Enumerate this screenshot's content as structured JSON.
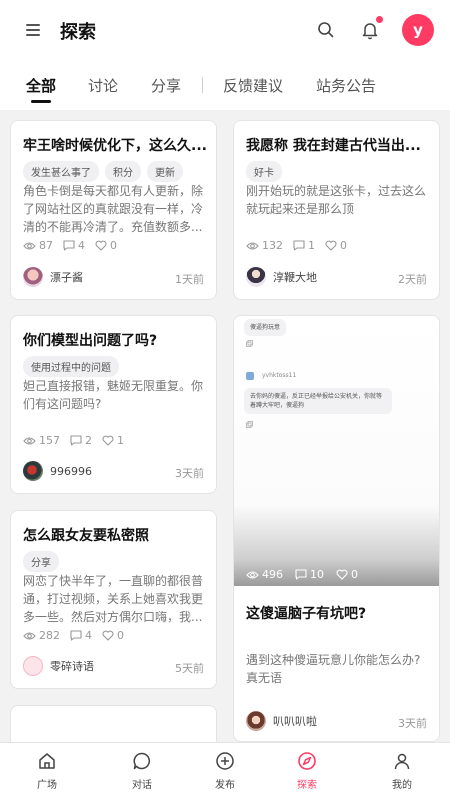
{
  "header": {
    "title": "探索",
    "avatar_letter": "y"
  },
  "tabs": [
    {
      "label": "全部",
      "active": true
    },
    {
      "label": "讨论"
    },
    {
      "label": "分享"
    },
    {
      "label": "反馈建议"
    },
    {
      "label": "站务公告"
    }
  ],
  "posts": [
    {
      "title": "牢王啥时候优化下，这么久...",
      "tags": [
        "发生甚么事了",
        "积分",
        "更新"
      ],
      "excerpt": "角色卡倒是每天都见有人更新，除了网站社区的真就跟没有一样，冷清的不能再冷清了。充值数额多...",
      "views": "87",
      "comments": "4",
      "likes": "0",
      "author": "漂子酱",
      "time": "1天前"
    },
    {
      "title": "我愿称 我在封建古代当出...",
      "tags": [
        "好卡"
      ],
      "excerpt": "刚开始玩的就是这张卡，过去这么就玩起来还是那么顶",
      "views": "132",
      "comments": "1",
      "likes": "0",
      "author": "淳鞭大地",
      "time": "2天前"
    },
    {
      "title": "你们模型出问题了吗?",
      "tags": [
        "使用过程中的问题"
      ],
      "excerpt": "妲己直接报错，魅姬无限重复。你们有这问题吗?",
      "views": "157",
      "comments": "2",
      "likes": "1",
      "author": "996996",
      "time": "3天前"
    },
    {
      "title": "这傻逼脑子有坑吧?",
      "tags": [],
      "excerpt": "遇到这种傻逼玩意儿你能怎么办?真无语",
      "views": "496",
      "comments": "10",
      "likes": "0",
      "author": "叭叭叭啦",
      "time": "3天前",
      "image_text": {
        "top_bubble": "傻逼狗玩意",
        "username": "yvhktoss11",
        "message": "去你妈的傻逼，反正已经举报给公安机关，你就等着蹲大牢吧，傻逼狗"
      }
    },
    {
      "title": "怎么跟女友要私密照",
      "tags": [
        "分享"
      ],
      "excerpt": "网恋了快半年了，一直聊的都很普通，打过视频，关系上她喜欢我更多一些。然后对方偶尔口嗨，我...",
      "views": "282",
      "comments": "4",
      "likes": "0",
      "author": "零碎诗语",
      "time": "5天前"
    }
  ],
  "nav": [
    {
      "label": "广场",
      "icon": "home-icon"
    },
    {
      "label": "对话",
      "icon": "chat-icon"
    },
    {
      "label": "发布",
      "icon": "plus-circle-icon"
    },
    {
      "label": "探索",
      "icon": "compass-icon",
      "active": true
    },
    {
      "label": "我的",
      "icon": "user-icon"
    }
  ],
  "colors": {
    "accent": "#ff3b64",
    "background": "#f2f2f3"
  }
}
